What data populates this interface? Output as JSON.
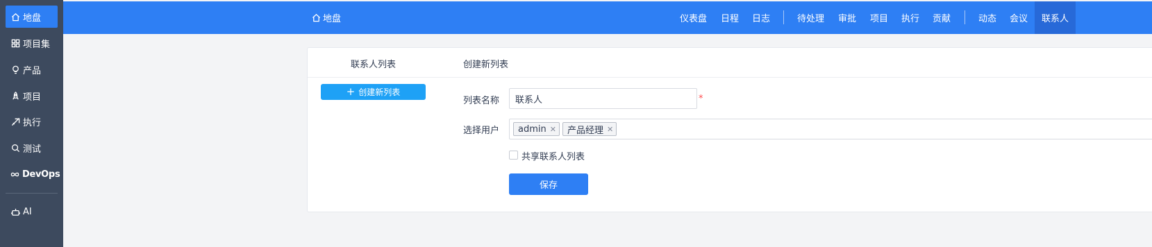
{
  "sidebar": {
    "items": [
      {
        "label": "地盘",
        "icon": "home-icon",
        "active": true
      },
      {
        "label": "项目集",
        "icon": "grid-icon"
      },
      {
        "label": "产品",
        "icon": "lightbulb-icon"
      },
      {
        "label": "项目",
        "icon": "rocket-icon"
      },
      {
        "label": "执行",
        "icon": "send-icon"
      },
      {
        "label": "测试",
        "icon": "search-bug-icon"
      },
      {
        "label": "DevOps",
        "icon": "infinity-icon"
      },
      {
        "label": "AI",
        "icon": "robot-icon"
      }
    ]
  },
  "header": {
    "home_label": "地盘",
    "nav": [
      "仪表盘",
      "日程",
      "日志",
      "待处理",
      "审批",
      "项目",
      "执行",
      "贡献",
      "动态",
      "会议",
      "联系人"
    ],
    "active_nav": "联系人"
  },
  "panel": {
    "left_title": "联系人列表",
    "right_title": "创建新列表",
    "create_button": "创建新列表",
    "form": {
      "list_name_label": "列表名称",
      "list_name_value": "联系人",
      "required_mark": "*",
      "select_users_label": "选择用户",
      "selected_users": [
        "admin",
        "产品经理"
      ],
      "share_label": "共享联系人列表",
      "share_checked": false,
      "save_button": "保存"
    }
  },
  "colors": {
    "primary": "#2e7ff4",
    "sidebar_bg": "#3d4a5e",
    "create_button": "#1ea1f6",
    "required": "#ff4d4f"
  }
}
